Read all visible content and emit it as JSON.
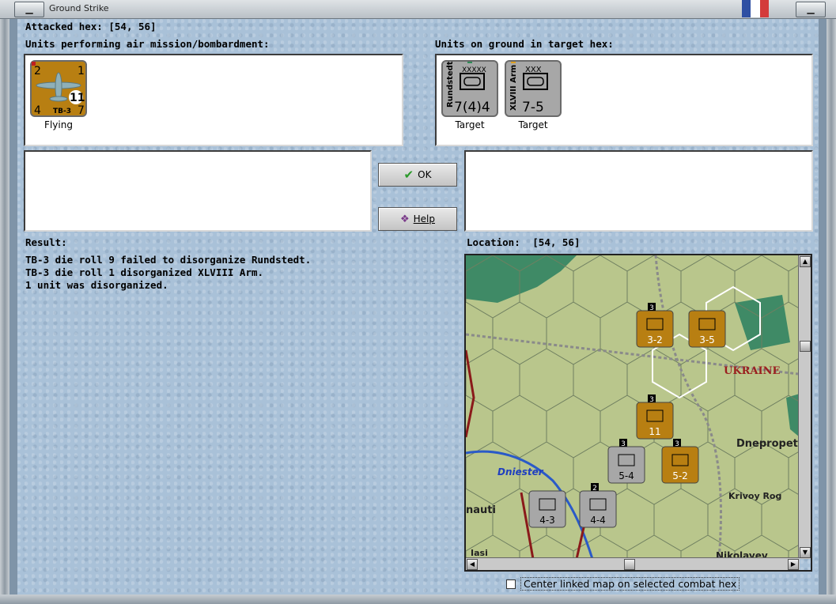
{
  "window": {
    "title": "Ground Strike",
    "flag_colors": [
      "#2e4fa3",
      "#ffffff",
      "#d33b3b"
    ]
  },
  "attacked_hex": {
    "label": "Attacked hex:",
    "value": "[54, 56]"
  },
  "air_section": {
    "heading": "Units performing air mission/bombardment:",
    "units": [
      {
        "name": "TB-3",
        "attack": "2",
        "range": "1",
        "defense": "4",
        "moves": "7",
        "strength": "11",
        "status": "Flying"
      }
    ]
  },
  "ground_section": {
    "heading": "Units on ground in target hex:",
    "units": [
      {
        "name": "Rundstedt",
        "size": "XXXXX",
        "values": "7(4)4",
        "status": "Target",
        "dot_color": "#2e8b57"
      },
      {
        "name": "XLVIII Arm",
        "size": "XXX",
        "values": "7-5",
        "status": "Target",
        "dot_color": "#e0a020"
      }
    ]
  },
  "buttons": {
    "ok": "OK",
    "help": "Help"
  },
  "result": {
    "label": "Result:",
    "lines": [
      "TB-3 die roll 9 failed to disorganize Rundstedt.",
      "TB-3 die roll 1 disorganized XLVIII Arm.",
      "1 unit was disorganized."
    ]
  },
  "location": {
    "label": "Location:",
    "value": "[54, 56]"
  },
  "map": {
    "labels": {
      "ukraine": "UKRAINE",
      "dniester": "Dniester",
      "dnepropet": "Dnepropet",
      "krivoy_rog": "Krivoy Rog",
      "nikolayev": "Nikolayev",
      "nauti": "nauti",
      "iasi": "Iasi"
    },
    "counters": [
      {
        "id": "a",
        "value": "3-2",
        "stack": "3",
        "color": "#b87f12"
      },
      {
        "id": "b",
        "value": "3-5",
        "stack": "",
        "color": "#b87f12"
      },
      {
        "id": "c",
        "value": "5-4",
        "stack": "3",
        "color": "#a7a7a7"
      },
      {
        "id": "d",
        "value": "5-2",
        "stack": "3",
        "color": "#b87f12"
      },
      {
        "id": "e",
        "value": "4-3",
        "stack": "",
        "color": "#a7a7a7"
      },
      {
        "id": "f",
        "value": "4-4",
        "stack": "2",
        "color": "#a7a7a7"
      },
      {
        "id": "g",
        "value": "11",
        "stack": "3",
        "color": "#b87f12"
      }
    ]
  },
  "center_map": {
    "label": "Center linked map on selected combat hex",
    "checked": false
  }
}
